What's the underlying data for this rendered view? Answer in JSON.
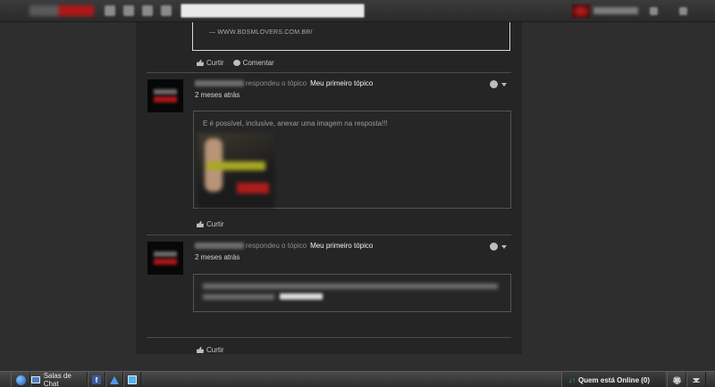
{
  "search": {
    "placeholder": "",
    "value": ""
  },
  "first_post": {
    "quote_text": "— WWW.BDSMLOVERS.COM.BR/",
    "actions": {
      "share": "Curtir",
      "comment": "Comentar"
    }
  },
  "replies": [
    {
      "verb": "respondeu o tópico",
      "topic": "Meu primeiro tópico",
      "date": "2 meses atrás",
      "body_text": "E é possível, inclusive, anexar uma imagem na resposta!!!",
      "like": "Curtir"
    },
    {
      "verb": "respondeu o tópico",
      "topic": "Meu primeiro tópico",
      "date": "2 meses atrás",
      "like": "Curtir"
    }
  ],
  "chat_bar": {
    "chat_rooms": "Salas de Chat",
    "fb_letter": "f",
    "online": "Quem está Online (0)",
    "online_arrows": "↓↑"
  },
  "colors": {
    "background": "#2e2e2e",
    "column": "#252525",
    "brand_red": "#b01818"
  }
}
